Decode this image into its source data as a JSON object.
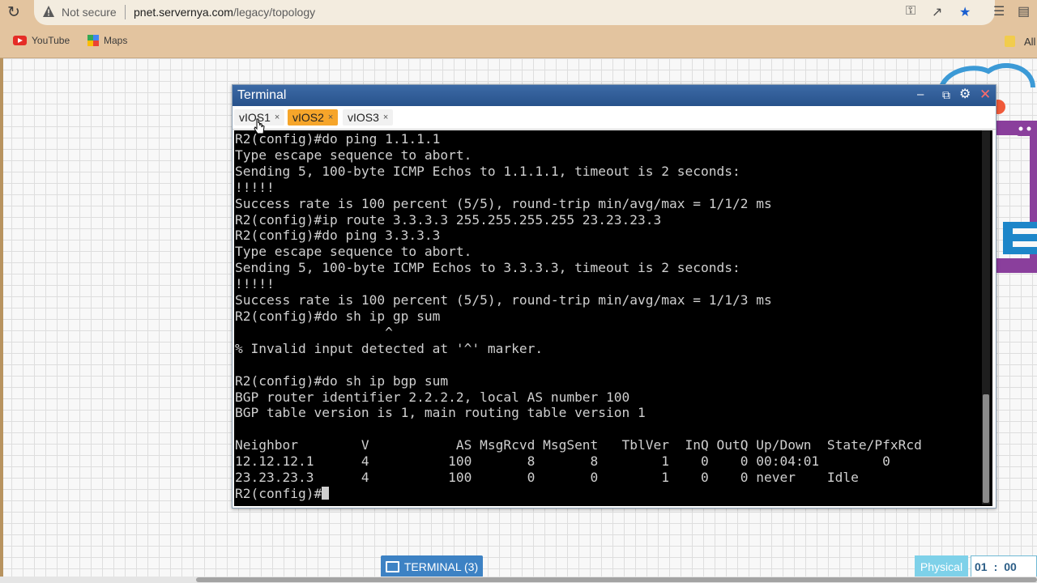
{
  "browser": {
    "security_label": "Not secure",
    "url_host": "pnet.servernya.com",
    "url_path": "/legacy/topology",
    "bookmarks": [
      {
        "label": "YouTube"
      },
      {
        "label": "Maps"
      }
    ],
    "bookmarks_overflow": "All"
  },
  "terminal": {
    "title": "Terminal",
    "tabs": [
      {
        "label": "vIOS1",
        "active": false
      },
      {
        "label": "vIOS2",
        "active": true
      },
      {
        "label": "vIOS3",
        "active": false
      }
    ],
    "close_glyph": "×",
    "lines": [
      "R2(config)#do ping 1.1.1.1",
      "Type escape sequence to abort.",
      "Sending 5, 100-byte ICMP Echos to 1.1.1.1, timeout is 2 seconds:",
      "!!!!!",
      "Success rate is 100 percent (5/5), round-trip min/avg/max = 1/1/2 ms",
      "R2(config)#ip route 3.3.3.3 255.255.255.255 23.23.23.3",
      "R2(config)#do ping 3.3.3.3",
      "Type escape sequence to abort.",
      "Sending 5, 100-byte ICMP Echos to 3.3.3.3, timeout is 2 seconds:",
      "!!!!!",
      "Success rate is 100 percent (5/5), round-trip min/avg/max = 1/1/3 ms",
      "R2(config)#do sh ip gp sum",
      "                   ^",
      "% Invalid input detected at '^' marker.",
      "",
      "R2(config)#do sh ip bgp sum",
      "BGP router identifier 2.2.2.2, local AS number 100",
      "BGP table version is 1, main routing table version 1",
      "",
      "Neighbor        V           AS MsgRcvd MsgSent   TblVer  InQ OutQ Up/Down  State/PfxRcd",
      "12.12.12.1      4          100       8       8        1    0    0 00:04:01        0",
      "23.23.23.3      4          100       0       0        1    0    0 never    Idle"
    ],
    "prompt": "R2(config)#"
  },
  "footer": {
    "terminal_button": "TERMINAL (3)",
    "mode_label": "Physical",
    "timer_hours": "01",
    "timer_sep": ":",
    "timer_minutes": "00"
  },
  "colors": {
    "chrome_bg": "#e3c49f",
    "terminal_titlebar": "#2d5a94",
    "active_tab": "#f6a52a",
    "terminal_bg": "#000000",
    "terminal_fg": "#cfcfcf"
  }
}
